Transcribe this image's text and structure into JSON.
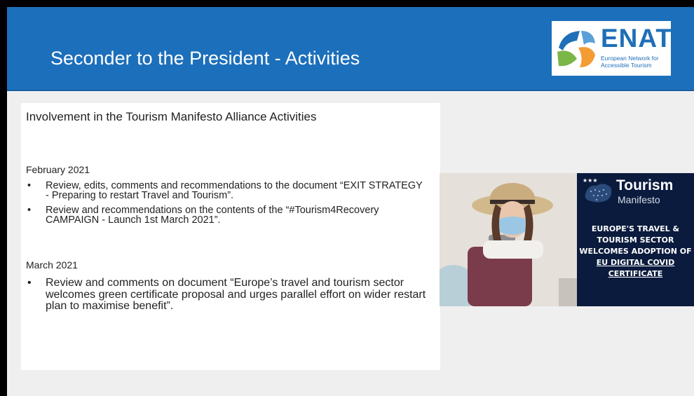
{
  "slide": {
    "title": "Seconder to the President - Activities",
    "logo": {
      "brand": "ENAT",
      "tagline_line1": "European Network for",
      "tagline_line2": "Accessible Tourism"
    }
  },
  "content": {
    "subtitle": "Involvement in the Tourism Manifesto Alliance Activities",
    "sections": [
      {
        "date": "February 2021",
        "items": [
          "Review, edits, comments and recommendations to the document “EXIT STRATEGY - Preparing to restart Travel and Tourism”.",
          "Review and recommendations on the contents of the “#Tourism4Recovery CAMPAIGN - Launch 1st March 2021”."
        ]
      },
      {
        "date": "March 2021",
        "items": [
          "Review and comments on document “Europe’s travel and tourism sector welcomes green certificate proposal and urges parallel effort on wider restart plan to maximise benefit”."
        ]
      }
    ]
  },
  "banner": {
    "brand_line1": "Tourism",
    "brand_line2": "Manifesto",
    "headline_lines": [
      "EUROPE'S TRAVEL &",
      "TOURISM SECTOR",
      "WELCOMES ADOPTION OF"
    ],
    "link_lines": [
      "EU DIGITAL COVID",
      "CERTIFICATE"
    ],
    "colors": {
      "background": "#0b1b3e",
      "text": "#ffffff"
    }
  },
  "colors": {
    "header": "#1c6fbb",
    "slide_bg": "#efefef",
    "enat_blue": "#1f6fb8",
    "enat_green": "#7ab648",
    "enat_orange": "#f39c34"
  }
}
